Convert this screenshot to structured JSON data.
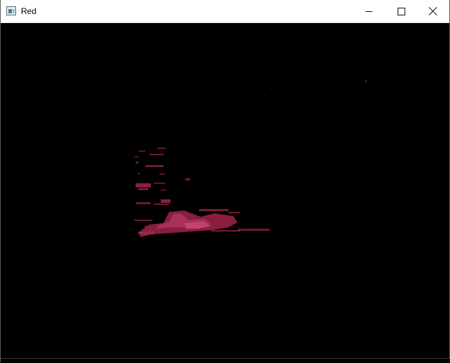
{
  "window": {
    "title": "Red",
    "icon": "opencv-window-icon"
  },
  "controls": {
    "minimize": "minimize-icon",
    "maximize": "maximize-icon",
    "close": "close-icon"
  },
  "image": {
    "description_channel": "red",
    "background": "#000000",
    "blob_color": "#8a1f3d",
    "highlight_color": "#b33a5c"
  }
}
